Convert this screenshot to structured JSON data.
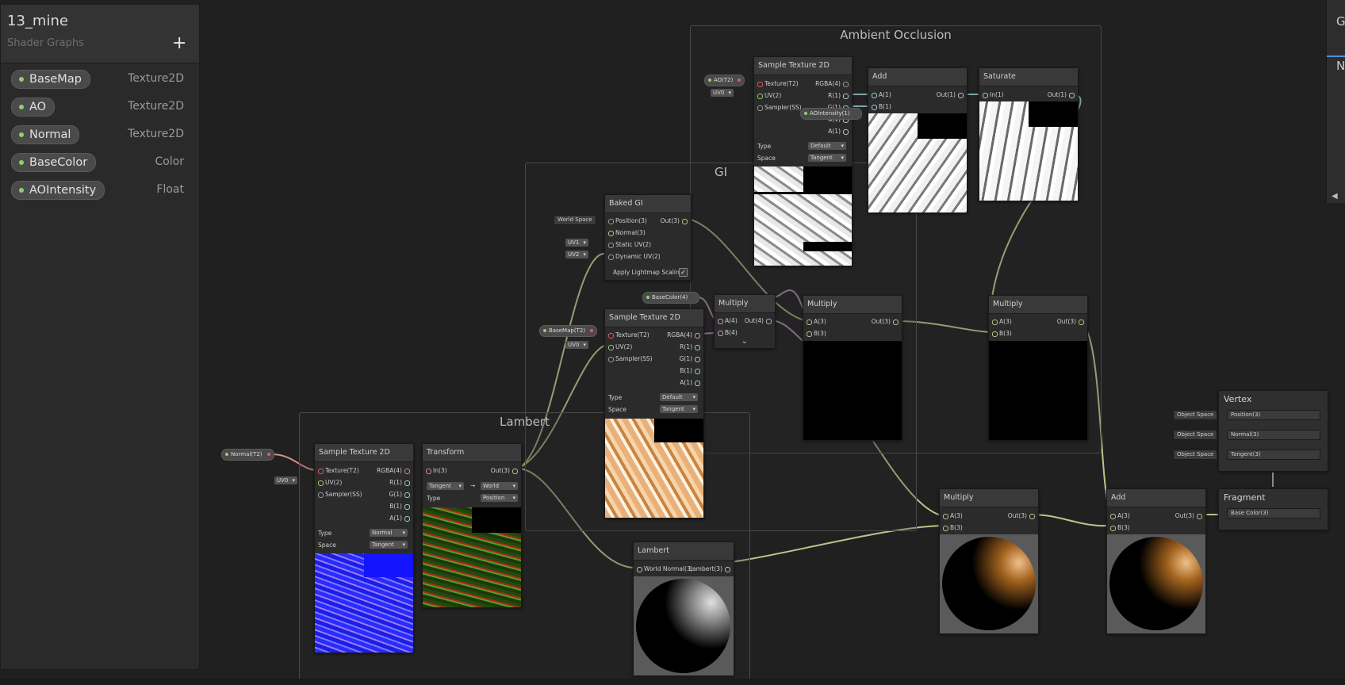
{
  "blackboard": {
    "title": "13_mine",
    "subtitle": "Shader Graphs",
    "add_label": "+",
    "properties": [
      {
        "name": "BaseMap",
        "type": "Texture2D"
      },
      {
        "name": "AO",
        "type": "Texture2D"
      },
      {
        "name": "Normal",
        "type": "Texture2D"
      },
      {
        "name": "BaseColor",
        "type": "Color"
      },
      {
        "name": "AOIntensity",
        "type": "Float"
      }
    ]
  },
  "groups": {
    "ao": "Ambient Occlusion",
    "gi": "GI",
    "lambert": "Lambert"
  },
  "right_panel": {
    "letter1": "G",
    "letter2": "N",
    "arrow": "◀"
  },
  "nodes": {
    "sample_ao": {
      "title": "Sample Texture 2D",
      "in": [
        "Texture(T2)",
        "UV(2)",
        "Sampler(SS)"
      ],
      "out": [
        "RGBA(4)",
        "R(1)",
        "G(1)",
        "B(1)",
        "A(1)"
      ],
      "type_label": "Type",
      "type_value": "Default",
      "space_label": "Space",
      "space_value": "Tangent"
    },
    "add_ao": {
      "title": "Add",
      "in": [
        "A(1)",
        "B(1)"
      ],
      "out": "Out(1)"
    },
    "saturate": {
      "title": "Saturate",
      "in": "In(1)",
      "out": "Out(1)"
    },
    "baked_gi": {
      "title": "Baked GI",
      "in": [
        "Position(3)",
        "Normal(3)",
        "Static UV(2)",
        "Dynamic UV(2)"
      ],
      "out": "Out(3)",
      "option": "Apply Lightmap Scaling",
      "option_check": "✓"
    },
    "multiply_color": {
      "title": "Multiply",
      "in": [
        "A(4)",
        "B(4)"
      ],
      "out": "Out(4)",
      "expand": "⌄"
    },
    "multiply_gi": {
      "title": "Multiply",
      "in": [
        "A(3)",
        "B(3)"
      ],
      "out": "Out(3)"
    },
    "multiply_ao": {
      "title": "Multiply",
      "in": [
        "A(3)",
        "B(3)"
      ],
      "out": "Out(3)"
    },
    "sample_base": {
      "title": "Sample Texture 2D",
      "in": [
        "Texture(T2)",
        "UV(2)",
        "Sampler(SS)"
      ],
      "out": [
        "RGBA(4)",
        "R(1)",
        "G(1)",
        "B(1)",
        "A(1)"
      ],
      "type_label": "Type",
      "type_value": "Default",
      "space_label": "Space",
      "space_value": "Tangent"
    },
    "sample_normal": {
      "title": "Sample Texture 2D",
      "in": [
        "Texture(T2)",
        "UV(2)",
        "Sampler(SS)"
      ],
      "out": [
        "RGBA(4)",
        "R(1)",
        "G(1)",
        "B(1)",
        "A(1)"
      ],
      "type_label": "Type",
      "type_value": "Normal",
      "space_label": "Space",
      "space_value": "Tangent"
    },
    "transform": {
      "title": "Transform",
      "in": "In(3)",
      "out": "Out(3)",
      "from": "Tangent",
      "arrow": "→",
      "to": "World",
      "type_label": "Type",
      "type_value": "Position"
    },
    "lambert": {
      "title": "Lambert",
      "in": "World Normal(3)",
      "out": "Lambert(3)"
    },
    "multiply_final": {
      "title": "Multiply",
      "in": [
        "A(3)",
        "B(3)"
      ],
      "out": "Out(3)"
    },
    "add_final": {
      "title": "Add",
      "in": [
        "A(3)",
        "B(3)"
      ],
      "out": "Out(3)"
    },
    "vertex": {
      "title": "Vertex",
      "in": [
        "Position(3)",
        "Normal(3)",
        "Tangent(3)"
      ],
      "space": "Object Space"
    },
    "fragment": {
      "title": "Fragment",
      "in": "Base Color(3)"
    }
  },
  "inputs": {
    "ao_prop": "AO(T2)",
    "ao_uv": "UV0",
    "ao_intensity": "AOIntensity(1)",
    "world_space": "World Space",
    "uv1": "UV1",
    "uv2": "UV2",
    "basecolor_prop": "BaseColor(4)",
    "basemap_prop": "BaseMap(T2)",
    "base_uv": "UV0",
    "normal_prop": "Normal(T2)",
    "normal_uv": "UV0"
  }
}
